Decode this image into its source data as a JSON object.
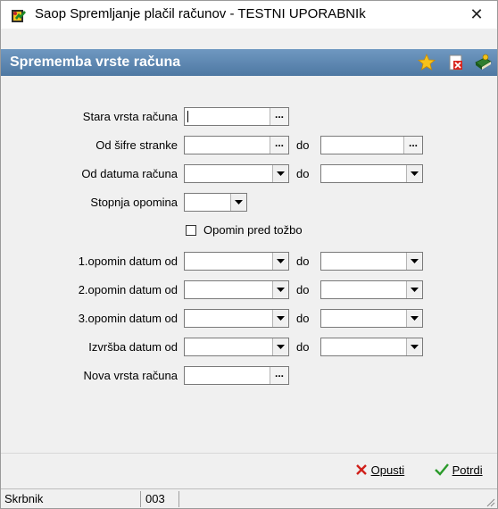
{
  "window": {
    "title": "Saop Spremljanje plačil računov - TESTNI UPORABNIk",
    "close_symbol": "✕"
  },
  "header": {
    "caption": "Sprememba vrste računa",
    "icons": [
      "star-icon",
      "delete-document-icon",
      "help-book-icon"
    ]
  },
  "form": {
    "stara_vrsta_label": "Stara vrsta računa",
    "od_sifre_label": "Od šifre stranke",
    "od_datuma_label": "Od datuma računa",
    "stopnja_label": "Stopnja opomina",
    "opomin_tozbo_label": "Opomin pred tožbo",
    "opomin1_label": "1.opomin datum od",
    "opomin2_label": "2.opomin datum od",
    "opomin3_label": "3.opomin datum od",
    "izvrsba_label": "Izvršba datum od",
    "nova_vrsta_label": "Nova vrsta računa",
    "do_label": "do",
    "browse_symbol": "...",
    "opomin_tozbo_checked": false
  },
  "footer": {
    "cancel_label": "Opusti",
    "confirm_label": "Potrdi"
  },
  "status": {
    "user": "Skrbnik",
    "code": "003"
  }
}
